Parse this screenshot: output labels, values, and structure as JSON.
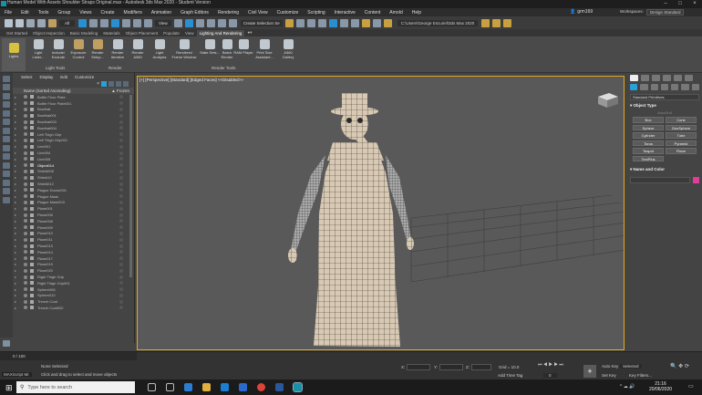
{
  "window": {
    "title": "Human Model With Assets Shoulder Straps Original.max - Autodesk 3ds Max 2020 - Student Version",
    "user": "grm169",
    "workspaces_label": "Workspaces:",
    "workspace_value": "Design Standard"
  },
  "menu": [
    "File",
    "Edit",
    "Tools",
    "Group",
    "Views",
    "Create",
    "Modifiers",
    "Animation",
    "Graph Editors",
    "Rendering",
    "Civil View",
    "Customize",
    "Scripting",
    "Interactive",
    "Content",
    "Arnold",
    "Help"
  ],
  "toolbar": {
    "view_dropdown": "View",
    "selection_set": "Create Selection Se",
    "path": "C:\\Users\\George Escuriel\\3ds Max 2020"
  },
  "ribbon_tabs": [
    "Get Started",
    "Object Inspection",
    "Basic Modeling",
    "Materials",
    "Object Placement",
    "Populate",
    "View",
    "Lighting And Rendering"
  ],
  "ribbon_active_tab": "Lighting And Rendering",
  "ribbon": {
    "lights": "Lights",
    "light_tools": [
      "Light Lister...",
      "Include/ Exclude",
      "Exposure Control"
    ],
    "render": [
      "Render Setup...",
      "Render Iterative",
      "Render A360"
    ],
    "render_tools": [
      "Light Analysis",
      "Rendered Frame Window",
      "State Sets...",
      "Batch Render",
      "RAM Player",
      "Print Size Assistant...",
      "A360 Gallery"
    ],
    "group_labels": [
      "Light Tools",
      "Render",
      "Render Tools"
    ]
  },
  "scene_explorer": {
    "menu": [
      "Select",
      "Display",
      "Edit",
      "Customize"
    ],
    "column_name": "Name (Sorted Ascending)",
    "column_frozen": "▲ Frozen",
    "items": [
      "Bottle Floor Plate",
      "Bottle Floor Plate001",
      "Bowlhat",
      "Bowlhat001",
      "Bowlhat003",
      "Bowlhat004",
      "Left Thigh Grip",
      "Left Thigh Grip001",
      "Line001",
      "Line004",
      "Line005",
      "Object014",
      "Shield008",
      "Shield10",
      "Shield012",
      "Plague Doctor001",
      "Plague Mask",
      "Plague Mask003",
      "Plane001",
      "Plane005",
      "Plane008",
      "Plane009",
      "Plane010",
      "Plane011",
      "Plane013",
      "Plane014",
      "Plane017",
      "Plane019",
      "Plane020",
      "Right Thigh Grip",
      "Right Thigh Grip001",
      "Sphere006",
      "Sphere010",
      "Trench Coat",
      "Trench Coat002"
    ],
    "selected_index": 11,
    "footer_scene": "Design Standard",
    "footer_selection": "Selection Set:"
  },
  "viewport": {
    "label": "[+] [Perspective] [Standard] [Edged Faces] <<Disabled>>"
  },
  "command_panel": {
    "dropdown": "Standard Primitives",
    "rollout_object_type": "Object Type",
    "autogrid": "AutoGrid",
    "objects": [
      "Box",
      "Cone",
      "Sphere",
      "GeoSphere",
      "Cylinder",
      "Tube",
      "Torus",
      "Pyramid",
      "Teapot",
      "Plane",
      "TextPlus"
    ],
    "rollout_name_color": "Name and Color",
    "object_color": "#e23c9b"
  },
  "status": {
    "frame": "0 / 100",
    "none_selected": "None Selected",
    "maxscript": "MAXScript Mi:",
    "prompt": "Click and drag to select and move objects",
    "x_label": "X:",
    "y_label": "Y:",
    "z_label": "Z:",
    "grid": "Grid = 10.0",
    "add_time_tag": "Add Time Tag",
    "auto_key": "Auto Key",
    "set_key": "Set Key",
    "selected": "Selected",
    "key_filters": "Key Filters...",
    "frame_value": "0"
  },
  "taskbar": {
    "search_placeholder": "Type here to search",
    "time": "21:16",
    "date": "20/06/2020"
  },
  "colors": {
    "accent": "#e3a824",
    "highlight": "#2aa0d8"
  }
}
